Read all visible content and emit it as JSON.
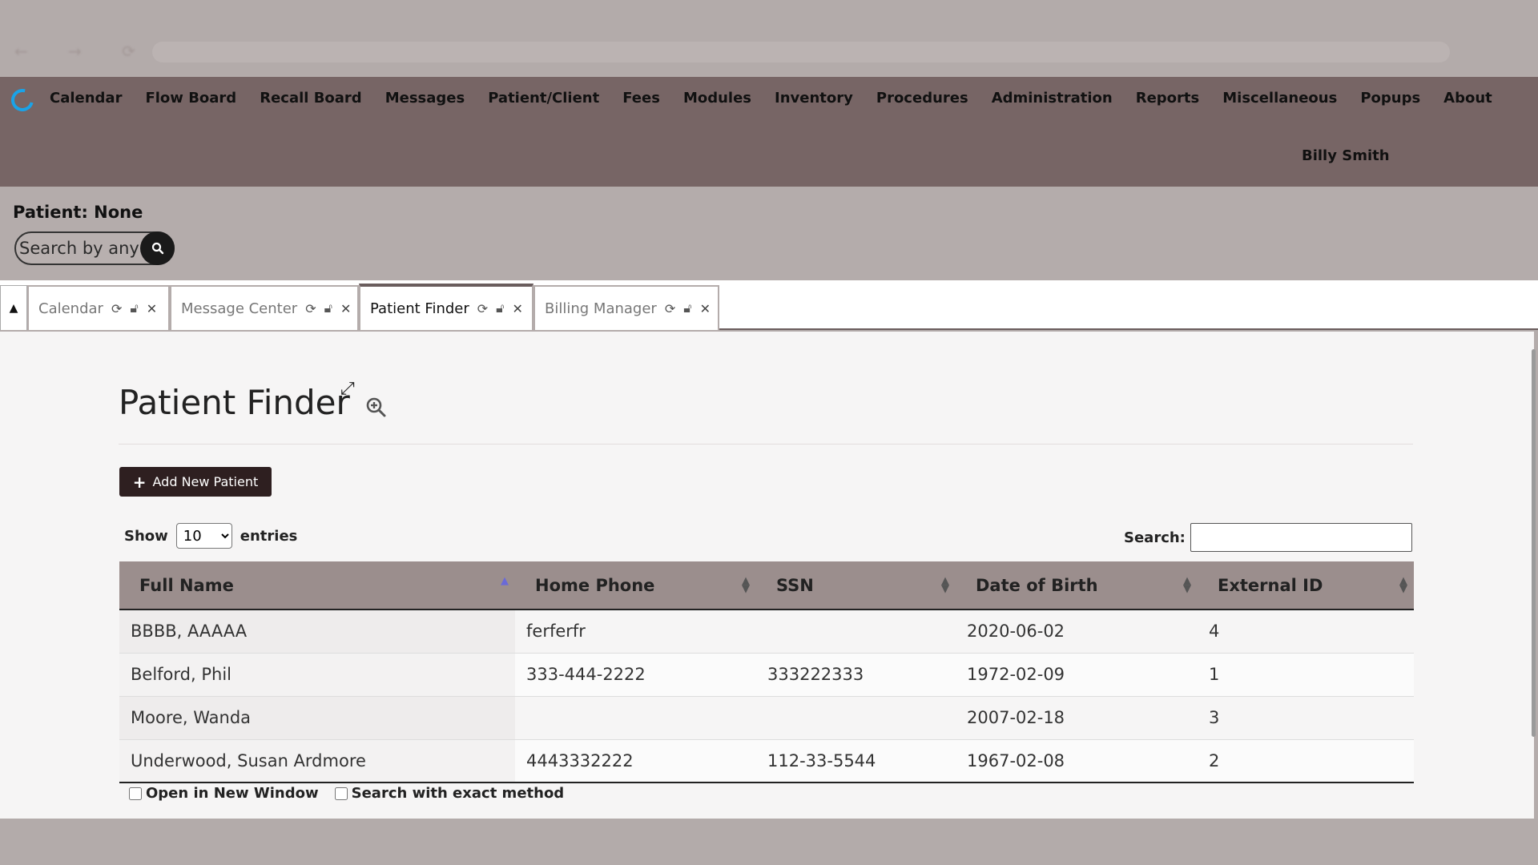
{
  "app": {
    "menu": [
      {
        "label": "Calendar"
      },
      {
        "label": "Flow Board"
      },
      {
        "label": "Recall Board"
      },
      {
        "label": "Messages"
      },
      {
        "label": "Patient/Client"
      },
      {
        "label": "Fees"
      },
      {
        "label": "Modules"
      },
      {
        "label": "Inventory"
      },
      {
        "label": "Procedures"
      },
      {
        "label": "Administration"
      },
      {
        "label": "Reports"
      },
      {
        "label": "Miscellaneous"
      },
      {
        "label": "Popups"
      },
      {
        "label": "About"
      }
    ],
    "user": "Billy Smith"
  },
  "patient_bar": {
    "label": "Patient: None",
    "search_placeholder": "Search by any demographics"
  },
  "tabs": [
    {
      "label": "Calendar",
      "active": false
    },
    {
      "label": "Message Center",
      "active": false
    },
    {
      "label": "Patient Finder",
      "active": true
    },
    {
      "label": "Billing Manager",
      "active": false
    }
  ],
  "page": {
    "title": "Patient Finder",
    "add_button": "Add New Patient",
    "show_label": "Show",
    "entries_label": "entries",
    "page_size": "10",
    "page_size_options": [
      "10"
    ],
    "search_label": "Search:",
    "search_value": ""
  },
  "table": {
    "columns": [
      "Full Name",
      "Home Phone",
      "SSN",
      "Date of Birth",
      "External ID"
    ],
    "rows": [
      [
        "BBBB, AAAAA",
        "ferferfr",
        "",
        "2020-06-02",
        "4"
      ],
      [
        "Belford, Phil",
        "333-444-2222",
        "333222333",
        "1972-02-09",
        "1"
      ],
      [
        "Moore, Wanda",
        "",
        "",
        "2007-02-18",
        "3"
      ],
      [
        "Underwood, Susan Ardmore",
        "4443332222",
        "112-33-5544",
        "1967-02-08",
        "2"
      ]
    ]
  },
  "options": {
    "new_window": "Open in New Window",
    "exact_method": "Search with exact method"
  },
  "colors": {
    "nav_bg": "#776565",
    "accent_dark": "#2e1f20",
    "logo_blue": "#1aa3e8"
  }
}
